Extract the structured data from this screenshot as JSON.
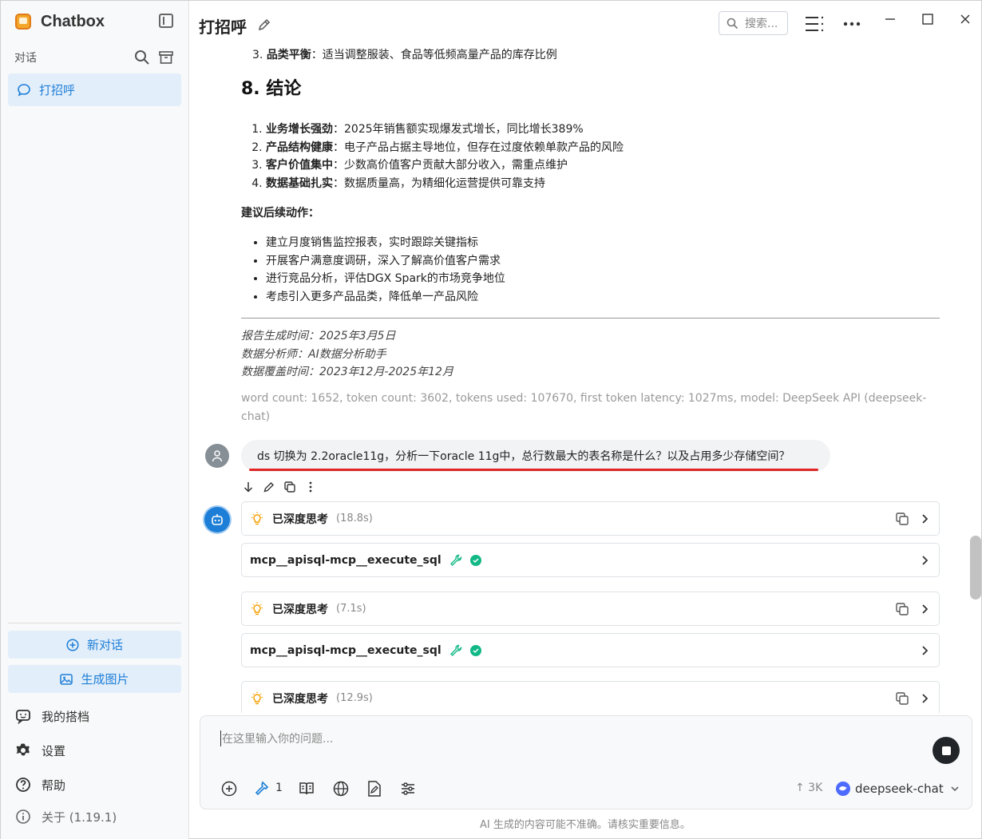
{
  "sidebar": {
    "app_name": "Chatbox",
    "section_title": "对话",
    "conversations": [
      {
        "label": "打招呼"
      }
    ],
    "new_chat": "新对话",
    "gen_image": "生成图片",
    "my_copilots": "我的搭档",
    "settings": "设置",
    "help": "帮助",
    "about": "关于 (1.19.1)"
  },
  "header": {
    "title": "打招呼",
    "search_placeholder": "搜索..."
  },
  "message": {
    "list_prev": {
      "num": "3.",
      "bold": "品类平衡",
      "text": "：适当调整服装、食品等低频高量产品的库存比例"
    },
    "heading": "8. 结论",
    "conclusions": [
      {
        "bold": "业务增长强劲",
        "text": "：2025年销售额实现爆发式增长，同比增长389%"
      },
      {
        "bold": "产品结构健康",
        "text": "：电子产品占据主导地位，但存在过度依赖单款产品的风险"
      },
      {
        "bold": "客户价值集中",
        "text": "：少数高价值客户贡献大部分收入，需重点维护"
      },
      {
        "bold": "数据基础扎实",
        "text": "：数据质量高，为精细化运营提供可靠支持"
      }
    ],
    "followup_title": "建议后续动作：",
    "followups": [
      "建立月度销售监控报表，实时跟踪关键指标",
      "开展客户满意度调研，深入了解高价值客户需求",
      "进行竞品分析，评估DGX Spark的市场竞争地位",
      "考虑引入更多产品品类，降低单一产品风险"
    ],
    "footer_lines": [
      "报告生成时间：2025年3月5日",
      "数据分析师：AI数据分析助手",
      "数据覆盖时间：2023年12月-2025年12月"
    ],
    "meta": "word count: 1652, token count: 3602, tokens used: 107670, first token latency: 1027ms, model: DeepSeek API (deepseek-chat)"
  },
  "user_message": "ds 切换为 2.2oracle11g，分析一下oracle 11g中，总行数最大的表名称是什么？以及占用多少存储空间？",
  "assistant_cards": [
    {
      "type": "think",
      "label": "已深度思考",
      "duration": "(18.8s)"
    },
    {
      "type": "tool",
      "label": "mcp__apisql-mcp__execute_sql"
    },
    {
      "type": "think",
      "label": "已深度思考",
      "duration": "(7.1s)"
    },
    {
      "type": "tool",
      "label": "mcp__apisql-mcp__execute_sql"
    },
    {
      "type": "think",
      "label": "已深度思考",
      "duration": "(12.9s)"
    }
  ],
  "input": {
    "placeholder": "在这里输入你的问题...",
    "tools_count": "1",
    "token_estimate": "↑ 3K",
    "model": "deepseek-chat"
  },
  "disclaimer": "AI 生成的内容可能不准确。请核实重要信息。",
  "colors": {
    "accent": "#1c7ed6",
    "success": "#12b886",
    "highlight": "#e02424",
    "think": "#f59f00"
  }
}
